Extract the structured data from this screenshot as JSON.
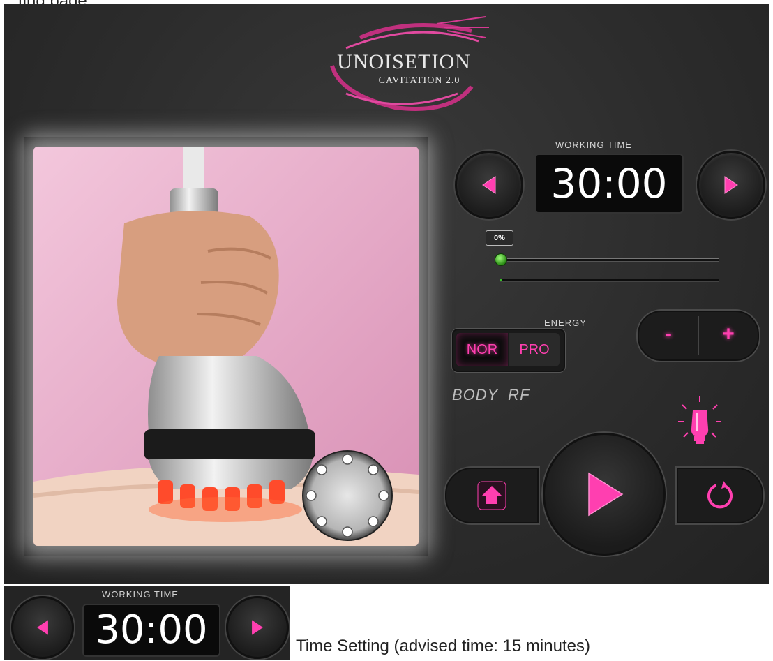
{
  "top_caption": "...ting page",
  "logo": {
    "title": "UNOISETION",
    "subtitle": "CAVITATION 2.0"
  },
  "working_time": {
    "label": "WORKING TIME",
    "value": "30:00"
  },
  "slider": {
    "percent_label": "0%",
    "level": 0
  },
  "progress": {
    "fraction": 0.01
  },
  "energy": {
    "label": "ENERGY",
    "modes": [
      "NOR",
      "PRO"
    ],
    "selected": "NOR",
    "minus_label": "-",
    "plus_label": "+"
  },
  "mode_caption": "BODY  RF",
  "bottom": {
    "label": "WORKING TIME",
    "value": "30:00"
  },
  "caption": "Time Setting (advised time: 15 minutes)",
  "colors": {
    "accent": "#ff3fb0",
    "panel_bg": "#2c2c2c",
    "progress_green": "#39c12a"
  },
  "icons": [
    "left-arrow-icon",
    "right-arrow-icon",
    "home-icon",
    "play-icon",
    "reset-icon",
    "lightbulb-icon"
  ]
}
